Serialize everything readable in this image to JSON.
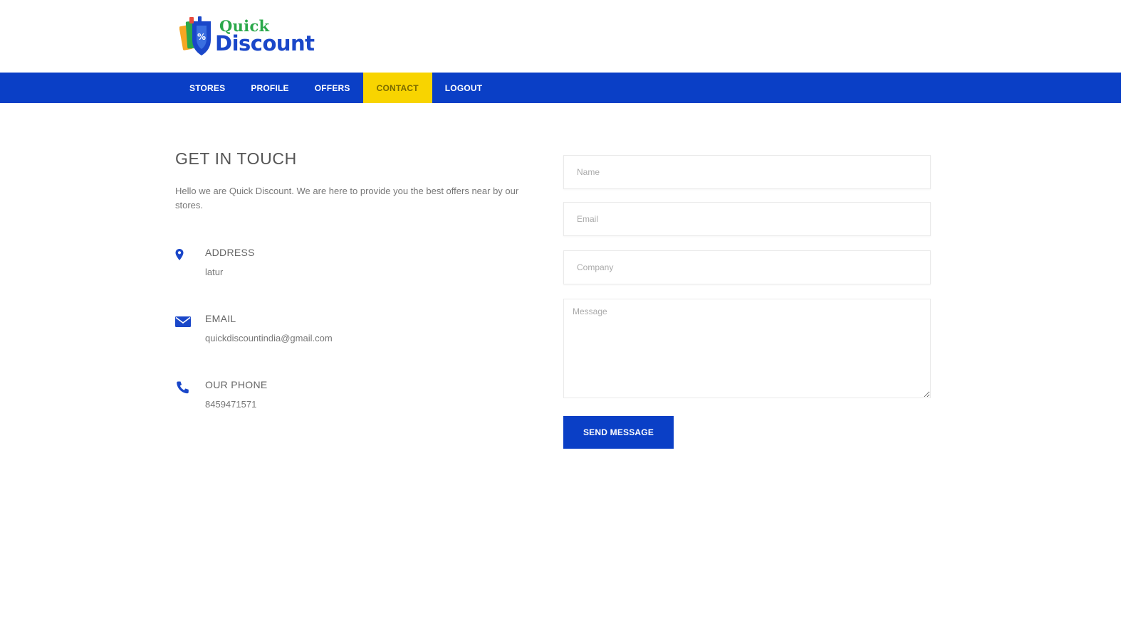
{
  "brand": {
    "logo_line1": "Quick",
    "logo_line2": "Discount",
    "colors": {
      "blue": "#0a3fc6",
      "green": "#2aa84a",
      "yellow": "#f8d400"
    }
  },
  "nav": {
    "items": [
      {
        "label": "STORES",
        "active": false
      },
      {
        "label": "PROFILE",
        "active": false
      },
      {
        "label": "OFFERS",
        "active": false
      },
      {
        "label": "CONTACT",
        "active": true
      },
      {
        "label": "LOGOUT",
        "active": false
      }
    ]
  },
  "contact": {
    "title": "GET IN TOUCH",
    "intro": "Hello we are Quick Discount. We are here to provide you the best offers near by our stores.",
    "address": {
      "label": "ADDRESS",
      "value": "latur",
      "icon": "map-pin-icon"
    },
    "email": {
      "label": "EMAIL",
      "value": "quickdiscountindia@gmail.com",
      "icon": "envelope-icon"
    },
    "phone": {
      "label": "OUR PHONE",
      "value": "8459471571",
      "icon": "phone-icon"
    }
  },
  "form": {
    "name_placeholder": "Name",
    "email_placeholder": "Email",
    "company_placeholder": "Company",
    "message_placeholder": "Message",
    "send_label": "SEND MESSAGE"
  }
}
